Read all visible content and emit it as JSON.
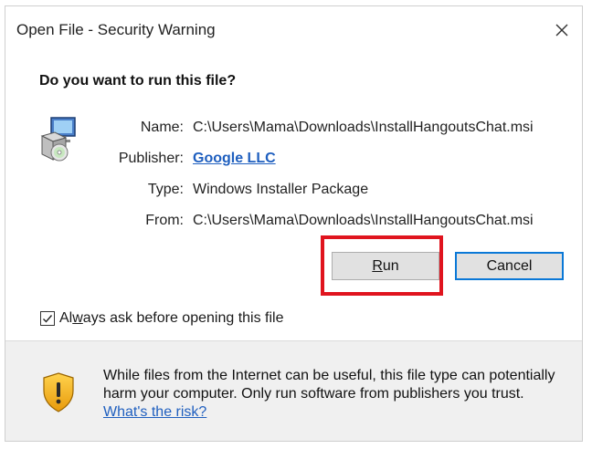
{
  "window": {
    "title": "Open File - Security Warning",
    "close_icon": "close-icon"
  },
  "question": "Do you want to run this file?",
  "file_icon": "installer-package-icon",
  "details": {
    "name_label": "Name:",
    "name_value": "C:\\Users\\Mama\\Downloads\\InstallHangoutsChat.msi",
    "publisher_label": "Publisher:",
    "publisher_value": "Google LLC",
    "type_label": "Type:",
    "type_value": "Windows Installer Package",
    "from_label": "From:",
    "from_value": "C:\\Users\\Mama\\Downloads\\InstallHangoutsChat.msi"
  },
  "buttons": {
    "run_mnemonic": "R",
    "run_rest": "un",
    "cancel": "Cancel"
  },
  "checkbox": {
    "checked": true,
    "label_pre": "Al",
    "label_mnemonic": "w",
    "label_post": "ays ask before opening this file"
  },
  "footer": {
    "warning_icon": "shield-warning-icon",
    "line1": "While files from the Internet can be useful, this file type can potentially",
    "line2": "harm your computer. Only run software from publishers you trust.",
    "risk_link": "What's the risk?"
  },
  "colors": {
    "highlight": "#e0141e",
    "link": "#1f5fbf",
    "focus_border": "#0a78d7",
    "footer_bg": "#f0f0f0"
  }
}
